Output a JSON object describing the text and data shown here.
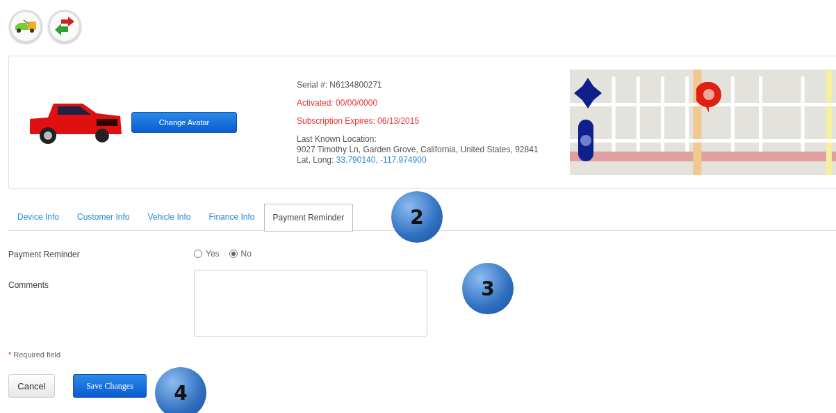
{
  "device": {
    "serial": "Serial #: N6134800271",
    "activated": "Activated: 00/00/0000",
    "expires": "Subscription Expires: 06/13/2015",
    "location_label": "Last Known Location:",
    "address": "9027 Timothy Ln, Garden Grove, California, United States, 92841",
    "latlong_label": "Lat, Long:",
    "latlong": "33.790140, -117.974900",
    "avatar_button": "Change Avatar"
  },
  "tabs": [
    {
      "label": "Device Info",
      "selected": false
    },
    {
      "label": "Customer Info",
      "selected": false
    },
    {
      "label": "Vehicle Info",
      "selected": false
    },
    {
      "label": "Finance Info",
      "selected": false
    },
    {
      "label": "Payment Reminder",
      "selected": true
    }
  ],
  "form": {
    "reminder_label": "Payment Reminder",
    "options": [
      {
        "label": "Yes",
        "selected": false
      },
      {
        "label": "No",
        "selected": true
      }
    ],
    "comments_label": "Comments",
    "required_mark": "*",
    "required_note": "Required field"
  },
  "buttons": {
    "cancel": "Cancel",
    "save": "Save Changes"
  },
  "step_badges": [
    "2",
    "3",
    "4"
  ]
}
